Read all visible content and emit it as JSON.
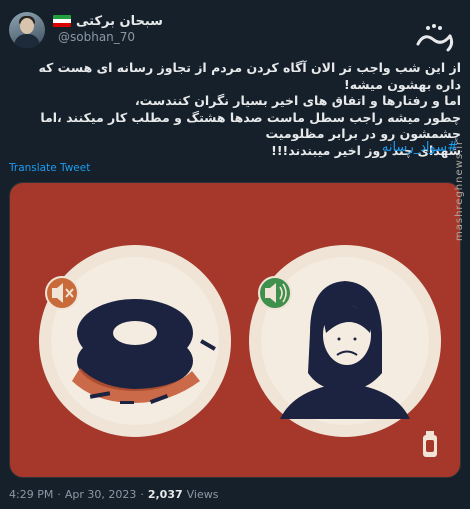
{
  "author": {
    "display_name": "سبحان برکتی",
    "handle": "@sobhan_70",
    "flag_icon": "iran-flag-icon",
    "flag_colors": [
      "#239f40",
      "#ffffff",
      "#da0000"
    ]
  },
  "brand": {
    "logo_text": "مشرق",
    "watermark": "mashreghnews.ir"
  },
  "tweet": {
    "lines": [
      "از این شب واجب تر الان آگاه کردن مردم از تجاوز رسانه ای هست که داره بهشون میشه!",
      "اما و رفتارها و اتفاق های اخیر بسیار نگران کنندست،",
      "چطور میشه راجب سطل ماست صدها هشتگ و مطلب کار میکنند ،اما چشمشون رو در برابر مظلومیت",
      "شهدای چند روز اخیر میبندند!!!"
    ],
    "hashtag": "#سواد_رسانه",
    "translate_label": "Translate Tweet"
  },
  "media": {
    "background_color": "#a5372b",
    "plate_color": "#efe4d6",
    "ink_color": "#1c2340",
    "left_badge_icon": "muted-speaker-icon",
    "right_badge_icon": "speaker-sound-icon",
    "left_badge_color": "#c86a3a",
    "right_badge_color": "#3f8f4d"
  },
  "meta": {
    "time": "4:29 PM",
    "separator": "·",
    "date": "Apr 30, 2023",
    "views_count": "2,037",
    "views_label": "Views"
  }
}
